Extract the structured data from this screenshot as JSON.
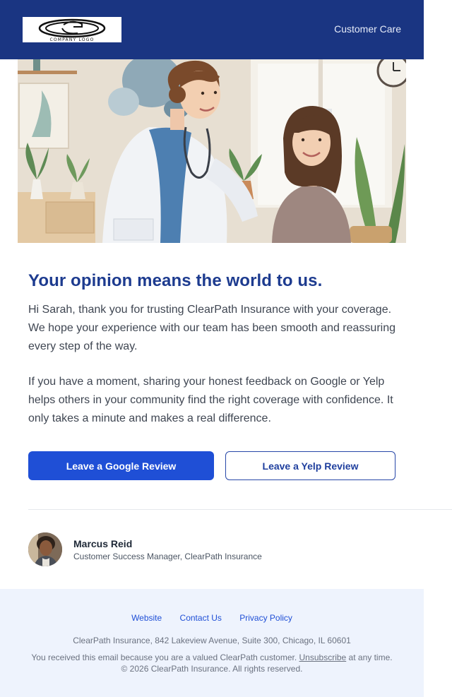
{
  "header": {
    "logo_text": "COMPANY LOGO",
    "nav_link": "Customer Care",
    "background": "#1a3582"
  },
  "hero": {
    "description_icon": "doctor-patient-illustration"
  },
  "content": {
    "heading": "Your opinion means the world to us.",
    "paragraph_1": "Hi Sarah, thank you for trusting ClearPath Insurance with your coverage. We hope your experience with our team has been smooth and reassuring every step of the way.",
    "paragraph_2": "If you have a moment, sharing your honest feedback on Google or Yelp helps others in your community find the right coverage with confidence. It only takes a minute and makes a real difference."
  },
  "buttons": {
    "google_label": "Leave a Google Review",
    "yelp_label": "Leave a Yelp Review",
    "primary_color": "#1f4fd6"
  },
  "signature": {
    "name": "Marcus Reid",
    "title": "Customer Success Manager, ClearPath Insurance"
  },
  "footer": {
    "links": [
      "Website",
      "Contact Us",
      "Privacy Policy"
    ],
    "address": "ClearPath Insurance, 842 Lakeview Avenue, Suite 300, Chicago, IL 60601",
    "disclaimer_before": "You received this email because you are a valued ClearPath customer. ",
    "unsubscribe": "Unsubscribe",
    "disclaimer_after": " at any time. © 2026 ClearPath Insurance. All rights reserved.",
    "background": "#eef3fd"
  }
}
